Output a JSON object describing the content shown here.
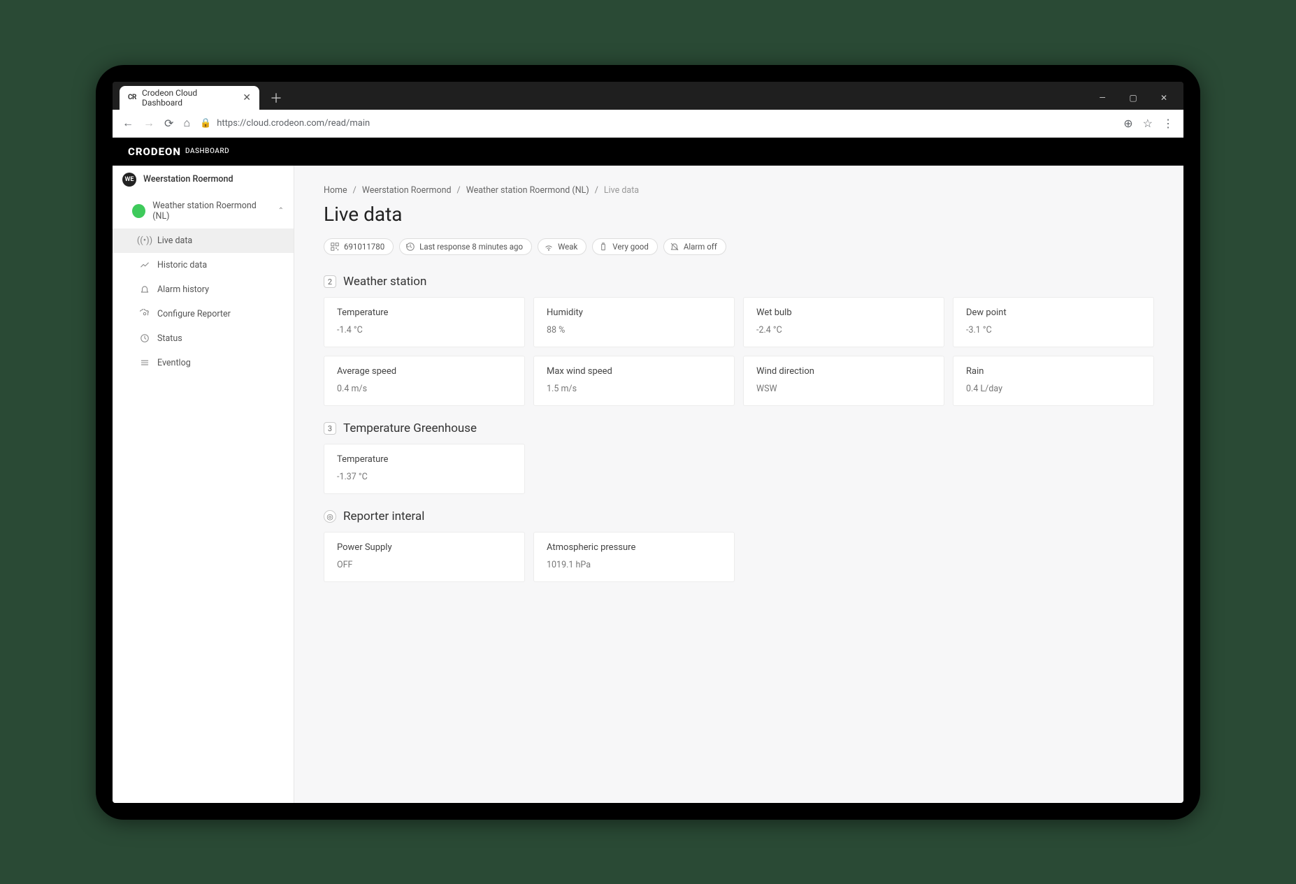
{
  "browser": {
    "tab_title": "Crodeon Cloud Dashboard",
    "favicon_text": "CR",
    "url": "https://cloud.crodeon.com/read/main"
  },
  "header": {
    "brand": "CRODEON",
    "brand_sub": "DASHBOARD"
  },
  "sidebar": {
    "root_avatar": "WE",
    "root_label": "Weerstation Roermond",
    "station_label": "Weather station Roermond (NL)",
    "items": [
      {
        "label": "Live data",
        "icon": "live"
      },
      {
        "label": "Historic data",
        "icon": "chart"
      },
      {
        "label": "Alarm history",
        "icon": "bell"
      },
      {
        "label": "Configure Reporter",
        "icon": "gear"
      },
      {
        "label": "Status",
        "icon": "clock"
      },
      {
        "label": "Eventlog",
        "icon": "list"
      }
    ]
  },
  "breadcrumb": {
    "items": [
      "Home",
      "Weerstation Roermond",
      "Weather station Roermond (NL)",
      "Live data"
    ]
  },
  "page_title": "Live data",
  "chips": [
    {
      "icon": "qr",
      "label": "691011780"
    },
    {
      "icon": "history",
      "label": "Last response 8 minutes ago"
    },
    {
      "icon": "wifi",
      "label": "Weak"
    },
    {
      "icon": "battery",
      "label": "Very good"
    },
    {
      "icon": "belloff",
      "label": "Alarm off"
    }
  ],
  "sections": [
    {
      "badge": "2",
      "title": "Weather station",
      "cards": [
        {
          "label": "Temperature",
          "value": "-1.4 °C"
        },
        {
          "label": "Humidity",
          "value": "88 %"
        },
        {
          "label": "Wet bulb",
          "value": "-2.4 °C"
        },
        {
          "label": "Dew point",
          "value": "-3.1 °C"
        },
        {
          "label": "Average speed",
          "value": "0.4 m/s"
        },
        {
          "label": "Max wind speed",
          "value": "1.5 m/s"
        },
        {
          "label": "Wind direction",
          "value": "WSW"
        },
        {
          "label": "Rain",
          "value": "0.4 L/day"
        }
      ]
    },
    {
      "badge": "3",
      "title": "Temperature Greenhouse",
      "cards": [
        {
          "label": "Temperature",
          "value": "-1.37 °C"
        }
      ]
    },
    {
      "badge": "◎",
      "title": "Reporter interal",
      "cards": [
        {
          "label": "Power Supply",
          "value": "OFF"
        },
        {
          "label": "Atmospheric pressure",
          "value": "1019.1 hPa"
        }
      ]
    }
  ]
}
